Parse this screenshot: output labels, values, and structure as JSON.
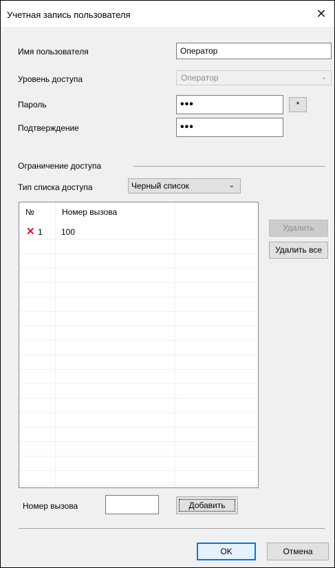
{
  "window": {
    "title": "Учетная запись пользователя",
    "close_glyph": "✕"
  },
  "form": {
    "username_label": "Имя пользователя",
    "username_value": "Оператор",
    "access_level_label": "Уровень доступа",
    "access_level_value": "Оператор",
    "password_label": "Пароль",
    "password_value": "•••",
    "password_button": "*",
    "confirm_label": "Подтверждение",
    "confirm_value": "•••"
  },
  "restriction": {
    "section_label": "Ограничение доступа",
    "list_type_label": "Тип списка доступа",
    "list_type_value": "Черный список"
  },
  "table": {
    "columns": [
      "№",
      "Номер вызова"
    ],
    "rows": [
      {
        "num": "1",
        "number": "100",
        "icon": "delete-x-icon"
      }
    ]
  },
  "side_buttons": {
    "delete": "Удалить",
    "delete_all": "Удалить все"
  },
  "add": {
    "number_label": "Номер вызова",
    "number_value": "",
    "add_button": "Добавить"
  },
  "footer": {
    "ok": "OK",
    "cancel": "Отмена"
  },
  "colors": {
    "accent": "#0078d7",
    "delete_icon": "#e81123"
  }
}
